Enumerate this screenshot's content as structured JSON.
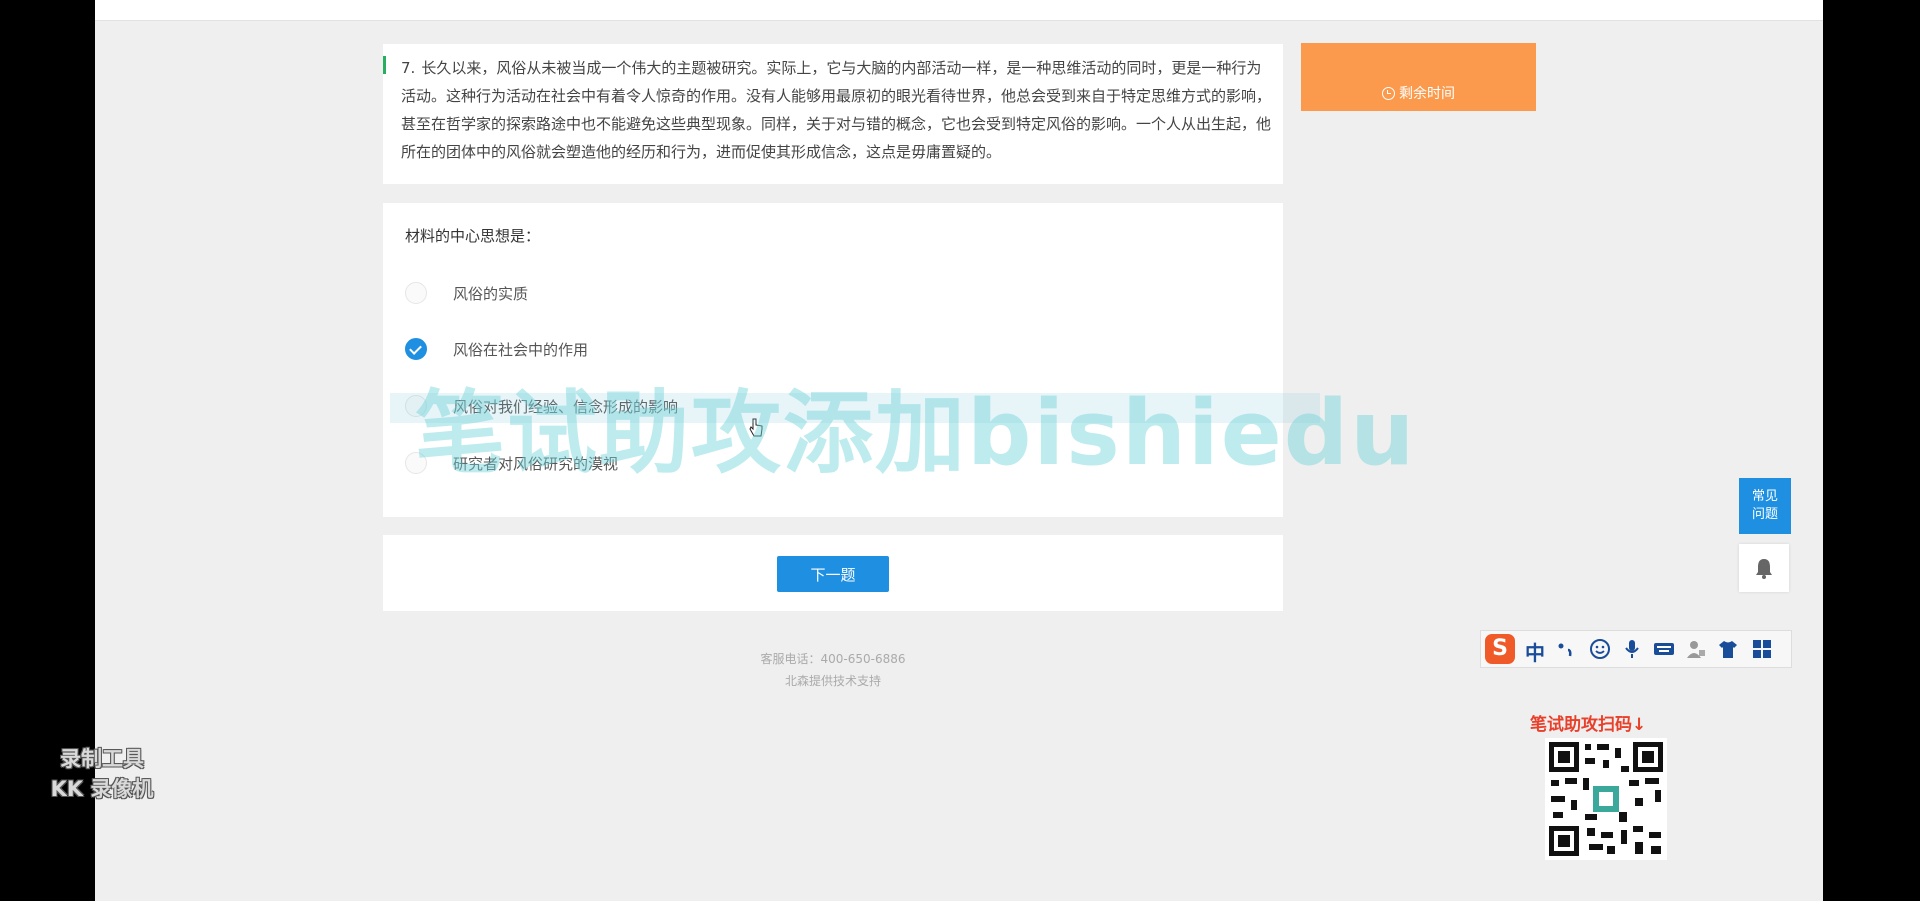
{
  "question": {
    "number": "7.",
    "passage": "长久以来，风俗从未被当成一个伟大的主题被研究。实际上，它与大脑的内部活动一样，是一种思维活动的同时，更是一种行为活动。这种行为活动在社会中有着令人惊奇的作用。没有人能够用最原初的眼光看待世界，他总会受到来自于特定思维方式的影响，甚至在哲学家的探索路途中也不能避免这些典型现象。同样，关于对与错的概念，它也会受到特定风俗的影响。一个人从出生起，他所在的团体中的风俗就会塑造他的经历和行为，进而促使其形成信念，这点是毋庸置疑的。",
    "prompt": "材料的中心思想是：",
    "options": [
      {
        "label": "风俗的实质",
        "selected": false
      },
      {
        "label": "风俗在社会中的作用",
        "selected": true
      },
      {
        "label": "风俗对我们经验、信念形成的影响",
        "selected": false
      },
      {
        "label": "研究者对风俗研究的漠视",
        "selected": false
      }
    ]
  },
  "timer": {
    "label": "剩余时间"
  },
  "next_button": {
    "label": "下一题"
  },
  "footer": {
    "phone_line": "客服电话：400-650-6886",
    "support_line": "北森提供技术支持"
  },
  "side": {
    "faq_line1": "常见",
    "faq_line2": "问题"
  },
  "ime": {
    "mode": "中"
  },
  "overlays": {
    "watermark": "笔试助攻添加bishiedu",
    "qr_title": "笔试助攻扫码↓",
    "recorder_line1": "录制工具",
    "recorder_line2": "KK 录像机"
  },
  "colors": {
    "accent": "#1e8fe1",
    "timer": "#fb9a4c",
    "passage_bar": "#27ae60"
  }
}
